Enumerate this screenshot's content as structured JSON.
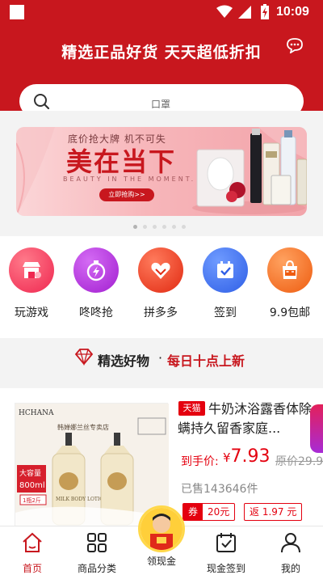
{
  "status": {
    "time": "10:09"
  },
  "header": {
    "slogan": "精选正品好货 天天超低折扣"
  },
  "search": {
    "placeholder": "口罩"
  },
  "banner": {
    "subtitle": "底价抢大牌 机不可失",
    "headline": "美在当下",
    "english": "BEAUTY IN THE MOMENT.",
    "button": "立即抢购>>",
    "pages": 6,
    "active_page": 1
  },
  "quick_icons": [
    {
      "label": "玩游戏",
      "icon": "store-game-icon",
      "color": "#f0365a"
    },
    {
      "label": "咚咚抢",
      "icon": "lightning-stopwatch-icon",
      "color": "#b02ad8"
    },
    {
      "label": "拼多多",
      "icon": "heart-gift-icon",
      "color": "#e5311c"
    },
    {
      "label": "签到",
      "icon": "calendar-check-icon",
      "color": "#3a6cf0"
    },
    {
      "label": "9.9包邮",
      "icon": "shopping-bag-icon",
      "color": "#f06a14"
    }
  ],
  "section": {
    "title": "精选好物",
    "separator": "·",
    "highlight": "每日十点上新"
  },
  "product": {
    "platform_tag": "天猫",
    "title": "牛奶沐浴露香体除螨持久留香家庭...",
    "price_label": "到手价:",
    "currency": "¥",
    "price": "7.93",
    "original_price": "原价29.9",
    "sold": "已售143646件",
    "coupon_label": "券",
    "coupon_value": "20元",
    "rebate": "返 1.97 元",
    "image_brand": "HCHANA",
    "image_store": "韩婵娜兰丝专卖店",
    "image_volume": "大容量",
    "image_size": "800ml",
    "image_offer": "1瓶2斤",
    "image_product": "MILK BODY LOTION"
  },
  "tabbar": [
    {
      "label": "首页",
      "icon": "home-icon",
      "active": true
    },
    {
      "label": "商品分类",
      "icon": "grid-category-icon",
      "active": false
    },
    {
      "label": "领现金",
      "icon": "cash-avatar-icon",
      "active": false
    },
    {
      "label": "现金签到",
      "icon": "calendar-check-icon",
      "active": false
    },
    {
      "label": "我的",
      "icon": "person-icon",
      "active": false
    }
  ]
}
